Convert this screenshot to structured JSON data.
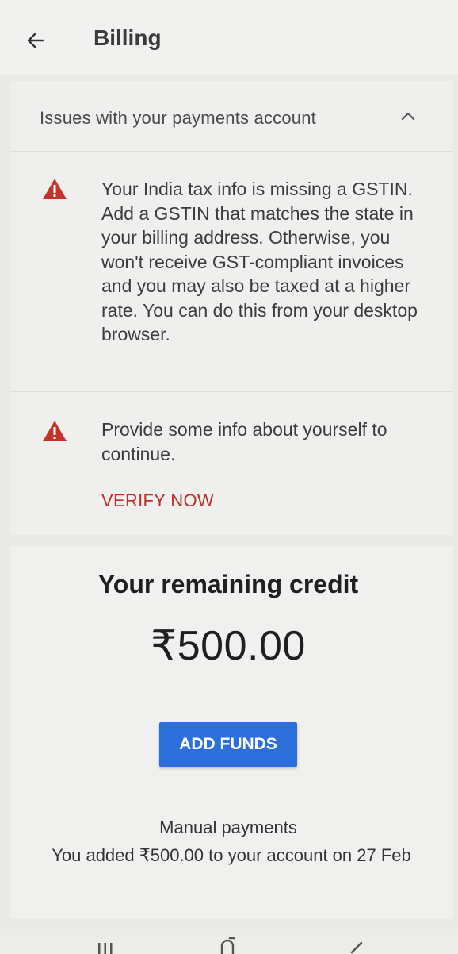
{
  "header": {
    "title": "Billing",
    "back_icon": "arrow-left-icon"
  },
  "issues": {
    "header_label": "Issues with your payments account",
    "toggle_icon": "chevron-up-icon",
    "items": [
      {
        "icon": "warning-icon",
        "text": "Your India tax info is missing a GSTIN. Add a GSTIN that matches the state in your billing address. Otherwise, you won't receive GST-compliant invoices and you may also be taxed at a higher rate. You can do this from your desktop browser."
      },
      {
        "icon": "warning-icon",
        "text": "Provide some info about yourself to continue.",
        "action_label": "VERIFY NOW"
      }
    ]
  },
  "credit": {
    "title": "Your remaining credit",
    "amount": "₹500.00",
    "add_funds_label": "ADD FUNDS",
    "manual_title": "Manual payments",
    "manual_description": "You added ₹500.00 to your account on 27 Feb"
  },
  "colors": {
    "warning": "#c5342c",
    "action_text": "#b8312f",
    "primary_button": "#2c6fdc"
  },
  "system_nav": {
    "recent_icon": "recent-apps-icon",
    "home_icon": "home-icon",
    "back_icon": "nav-back-icon"
  }
}
